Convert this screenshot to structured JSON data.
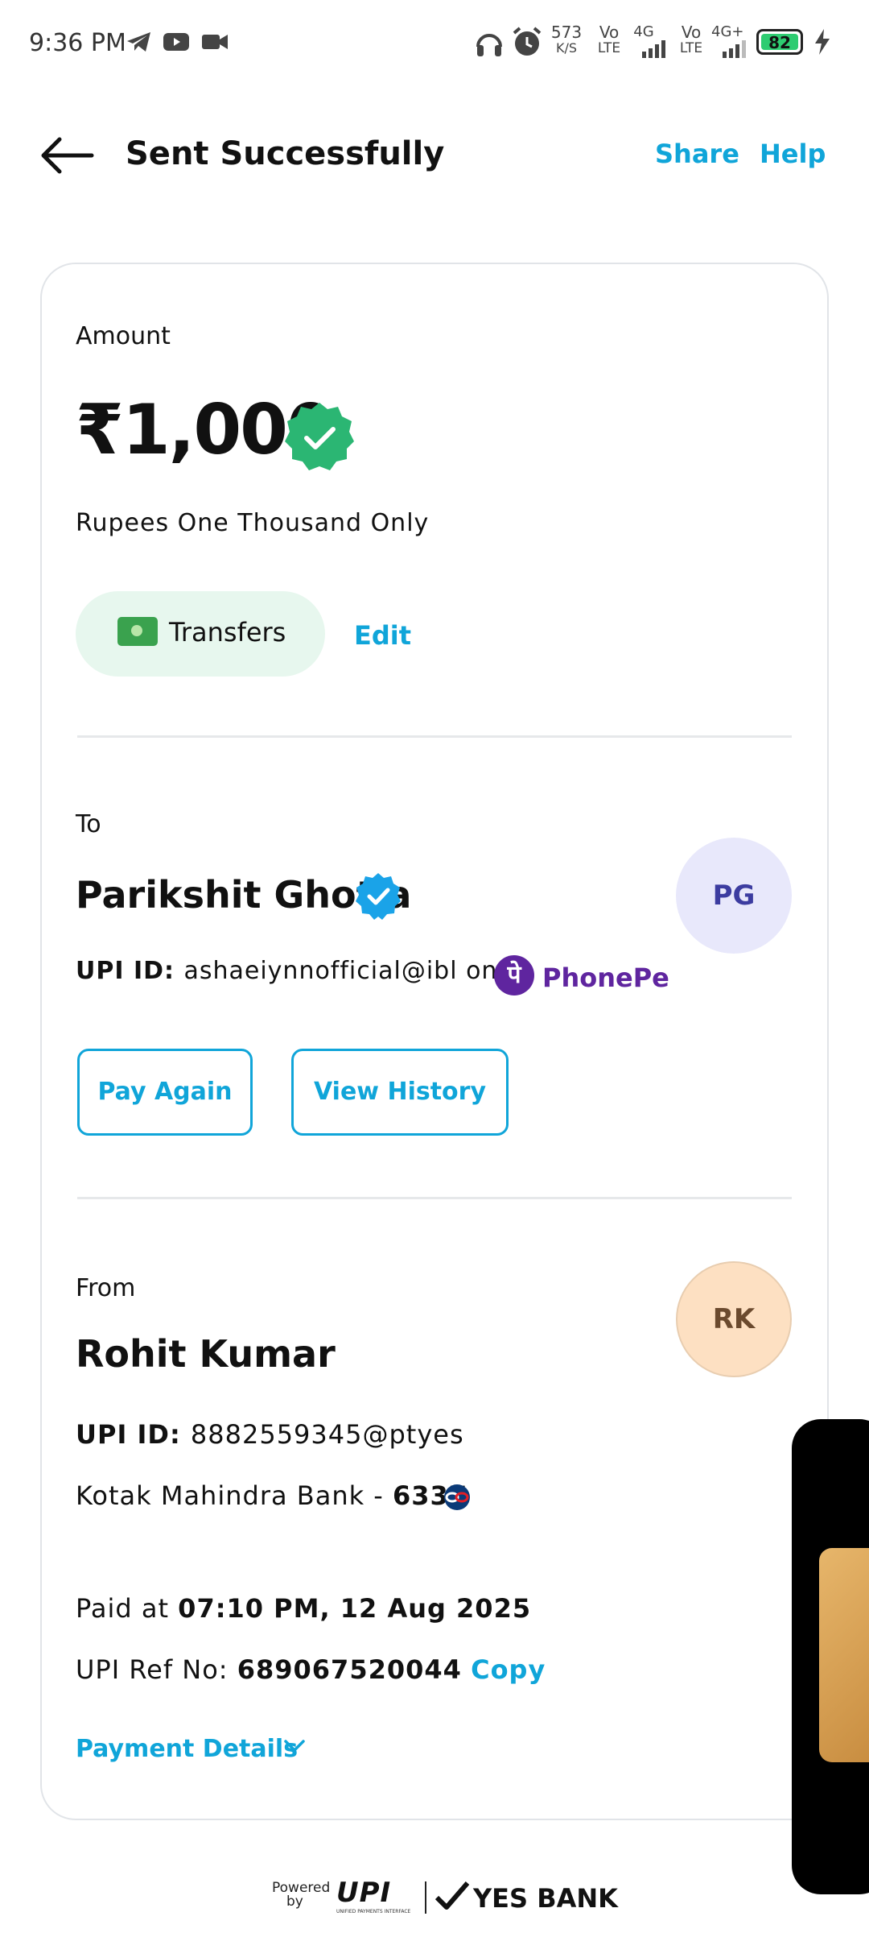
{
  "status_bar": {
    "time": "9:36 PM",
    "net_speed_value": "573",
    "net_speed_unit": "K/S",
    "sim1_top": "Vo",
    "sim1_bottom": "LTE",
    "sim1_net": "4G",
    "sim2_top": "Vo",
    "sim2_bottom": "LTE",
    "sim2_net": "4G+",
    "battery": "82"
  },
  "header": {
    "title": "Sent Successfully",
    "share": "Share",
    "help": "Help"
  },
  "amount": {
    "label": "Amount",
    "value": "₹1,000",
    "words": "Rupees One Thousand Only",
    "category": "Transfers",
    "edit": "Edit"
  },
  "to": {
    "label": "To",
    "name": "Parikshit Ghotia",
    "initials": "PG",
    "upi_label": "UPI ID: ",
    "upi_id": "ashaeiynnofficial@ibl",
    "on": " on ",
    "app_logo_glyph": "पे",
    "app_name": "PhonePe",
    "pay_again": "Pay Again",
    "view_history": "View History"
  },
  "from": {
    "label": "From",
    "name": "Rohit Kumar",
    "initials": "RK",
    "upi_label": "UPI ID: ",
    "upi_id": "8882559345@ptyes",
    "bank_label": "Kotak Mahindra Bank - ",
    "bank_digits": "6337"
  },
  "txn": {
    "paid_label": "Paid at ",
    "paid_value": "07:10 PM, 12 Aug 2025",
    "ref_label": "UPI Ref No: ",
    "ref_value": "689067520044",
    "copy": "Copy",
    "payment_details": "Payment Details"
  },
  "footer": {
    "powered": "Powered",
    "by": "by",
    "upi": "UPI",
    "upi_sub": "UNIFIED PAYMENTS INTERFACE",
    "bank": "YES BANK"
  },
  "colors": {
    "accent": "#10a5d9",
    "success": "#2bb673",
    "phonepe": "#5f259f"
  }
}
